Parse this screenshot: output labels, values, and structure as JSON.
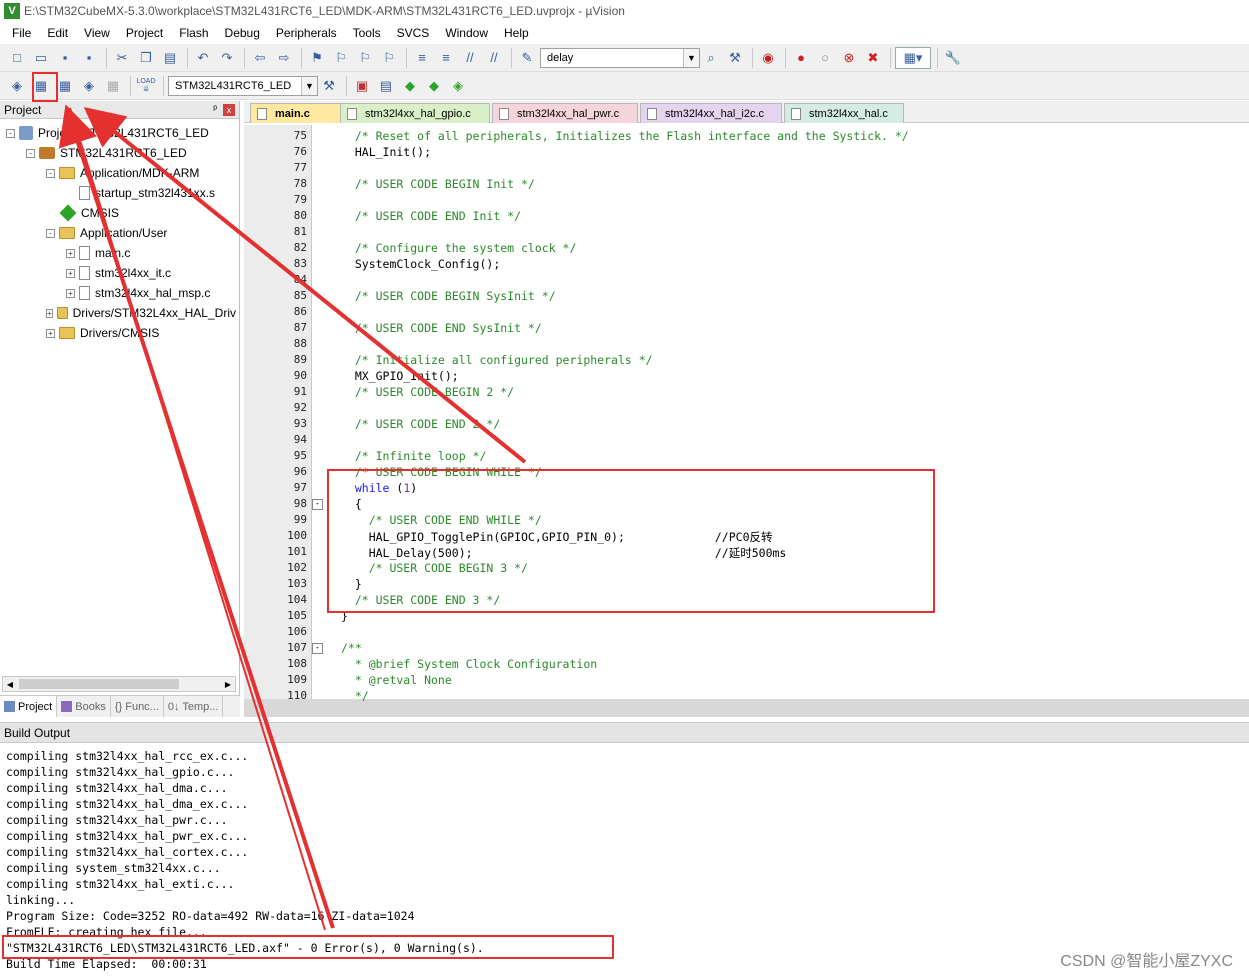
{
  "window": {
    "title": "E:\\STM32CubeMX-5.3.0\\workplace\\STM32L431RCT6_LED\\MDK-ARM\\STM32L431RCT6_LED.uvprojx - µVision",
    "app_icon": "V"
  },
  "menu": [
    "File",
    "Edit",
    "View",
    "Project",
    "Flash",
    "Debug",
    "Peripherals",
    "Tools",
    "SVCS",
    "Window",
    "Help"
  ],
  "toolbar": {
    "search_value": "delay",
    "target_value": "STM32L431RCT6_LED",
    "load_label": "LOAD"
  },
  "project_panel": {
    "title": "Project",
    "close_glyph": "x",
    "pin_glyph": "ᵖ",
    "tree": [
      {
        "label": "Project: STM32L431RCT6_LED",
        "depth": 0,
        "icon": "project-icon",
        "expander": "-"
      },
      {
        "label": "STM32L431RCT6_LED",
        "depth": 1,
        "icon": "target-icon",
        "expander": "-"
      },
      {
        "label": "Application/MDK-ARM",
        "depth": 2,
        "icon": "folder-icon",
        "expander": "-"
      },
      {
        "label": "startup_stm32l431xx.s",
        "depth": 3,
        "icon": "file-icon",
        "expander": ""
      },
      {
        "label": "CMSIS",
        "depth": 2,
        "icon": "gem-icon",
        "expander": ""
      },
      {
        "label": "Application/User",
        "depth": 2,
        "icon": "folder-icon",
        "expander": "-"
      },
      {
        "label": "main.c",
        "depth": 3,
        "icon": "file-icon",
        "expander": "+"
      },
      {
        "label": "stm32l4xx_it.c",
        "depth": 3,
        "icon": "file-icon",
        "expander": "+"
      },
      {
        "label": "stm32l4xx_hal_msp.c",
        "depth": 3,
        "icon": "file-icon",
        "expander": "+"
      },
      {
        "label": "Drivers/STM32L4xx_HAL_Driv",
        "depth": 2,
        "icon": "folder-icon",
        "expander": "+"
      },
      {
        "label": "Drivers/CMSIS",
        "depth": 2,
        "icon": "folder-icon",
        "expander": "+"
      }
    ],
    "tabs": [
      "Project",
      "Books",
      "{} Func...",
      "0↓ Temp..."
    ]
  },
  "editor": {
    "tabs": [
      {
        "label": "main.c",
        "color": "#ffe9a0"
      },
      {
        "label": "stm32l4xx_hal_gpio.c",
        "color": "#d8efc8"
      },
      {
        "label": "stm32l4xx_hal_pwr.c",
        "color": "#f6d4dc"
      },
      {
        "label": "stm32l4xx_hal_i2c.c",
        "color": "#e4d4f0"
      },
      {
        "label": "stm32l4xx_hal.c",
        "color": "#d4ece4"
      }
    ],
    "lines": [
      {
        "n": "75",
        "text": "  /* Reset of all peripherals, Initializes the Flash interface and the Systick. */",
        "kind": "cm"
      },
      {
        "n": "76",
        "text": "  HAL_Init();",
        "kind": "code"
      },
      {
        "n": "77",
        "text": "",
        "kind": "code"
      },
      {
        "n": "78",
        "text": "  /* USER CODE BEGIN Init */",
        "kind": "cm"
      },
      {
        "n": "79",
        "text": "",
        "kind": "code"
      },
      {
        "n": "80",
        "text": "  /* USER CODE END Init */",
        "kind": "cm"
      },
      {
        "n": "81",
        "text": "",
        "kind": "code"
      },
      {
        "n": "82",
        "text": "  /* Configure the system clock */",
        "kind": "cm"
      },
      {
        "n": "83",
        "text": "  SystemClock_Config();",
        "kind": "code"
      },
      {
        "n": "84",
        "text": "",
        "kind": "code"
      },
      {
        "n": "85",
        "text": "  /* USER CODE BEGIN SysInit */",
        "kind": "cm"
      },
      {
        "n": "86",
        "text": "",
        "kind": "code"
      },
      {
        "n": "87",
        "text": "  /* USER CODE END SysInit */",
        "kind": "cm"
      },
      {
        "n": "88",
        "text": "",
        "kind": "code"
      },
      {
        "n": "89",
        "text": "  /* Initialize all configured peripherals */",
        "kind": "cm"
      },
      {
        "n": "90",
        "text": "  MX_GPIO_Init();",
        "kind": "code"
      },
      {
        "n": "91",
        "text": "  /* USER CODE BEGIN 2 */",
        "kind": "cm"
      },
      {
        "n": "92",
        "text": "",
        "kind": "code"
      },
      {
        "n": "93",
        "text": "  /* USER CODE END 2 */",
        "kind": "cm"
      },
      {
        "n": "94",
        "text": "",
        "kind": "code"
      },
      {
        "n": "95",
        "text": "  /* Infinite loop */",
        "kind": "cm"
      },
      {
        "n": "96",
        "text": "  /* USER CODE BEGIN WHILE */",
        "kind": "cm"
      },
      {
        "n": "97",
        "text": "  while (1)",
        "kind": "while"
      },
      {
        "n": "98",
        "text": "  {",
        "kind": "code"
      },
      {
        "n": "99",
        "text": "    /* USER CODE END WHILE */",
        "kind": "cm"
      },
      {
        "n": "100",
        "text": "    HAL_GPIO_TogglePin(GPIOC,GPIO_PIN_0);             //PC0反转",
        "kind": "code"
      },
      {
        "n": "101",
        "text": "    HAL_Delay(500);                                   //延时500ms",
        "kind": "code"
      },
      {
        "n": "102",
        "text": "    /* USER CODE BEGIN 3 */",
        "kind": "cm"
      },
      {
        "n": "103",
        "text": "  }",
        "kind": "code"
      },
      {
        "n": "104",
        "text": "  /* USER CODE END 3 */",
        "kind": "cm"
      },
      {
        "n": "105",
        "text": "}",
        "kind": "code"
      },
      {
        "n": "106",
        "text": "",
        "kind": "code"
      },
      {
        "n": "107",
        "text": "/**",
        "kind": "cm"
      },
      {
        "n": "108",
        "text": "  * @brief System Clock Configuration",
        "kind": "cm"
      },
      {
        "n": "109",
        "text": "  * @retval None",
        "kind": "cm"
      },
      {
        "n": "110",
        "text": "  */",
        "kind": "cm"
      }
    ]
  },
  "build_output": {
    "title": "Build Output",
    "lines": [
      "compiling stm32l4xx_hal_rcc_ex.c...",
      "compiling stm32l4xx_hal_gpio.c...",
      "compiling stm32l4xx_hal_dma.c...",
      "compiling stm32l4xx_hal_dma_ex.c...",
      "compiling stm32l4xx_hal_pwr.c...",
      "compiling stm32l4xx_hal_pwr_ex.c...",
      "compiling stm32l4xx_hal_cortex.c...",
      "compiling system_stm32l4xx.c...",
      "compiling stm32l4xx_hal_exti.c...",
      "linking...",
      "Program Size: Code=3252 RO-data=492 RW-data=16 ZI-data=1024",
      "FromELF: creating hex file...",
      "\"STM32L431RCT6_LED\\STM32L431RCT6_LED.axf\" - 0 Error(s), 0 Warning(s).",
      "Build Time Elapsed:  00:00:31"
    ]
  },
  "watermark": "CSDN @智能小屋ZYXC",
  "colors": {
    "annotation": "#e53030",
    "comment": "#2a8a2a",
    "keyword": "#1a1aff"
  }
}
